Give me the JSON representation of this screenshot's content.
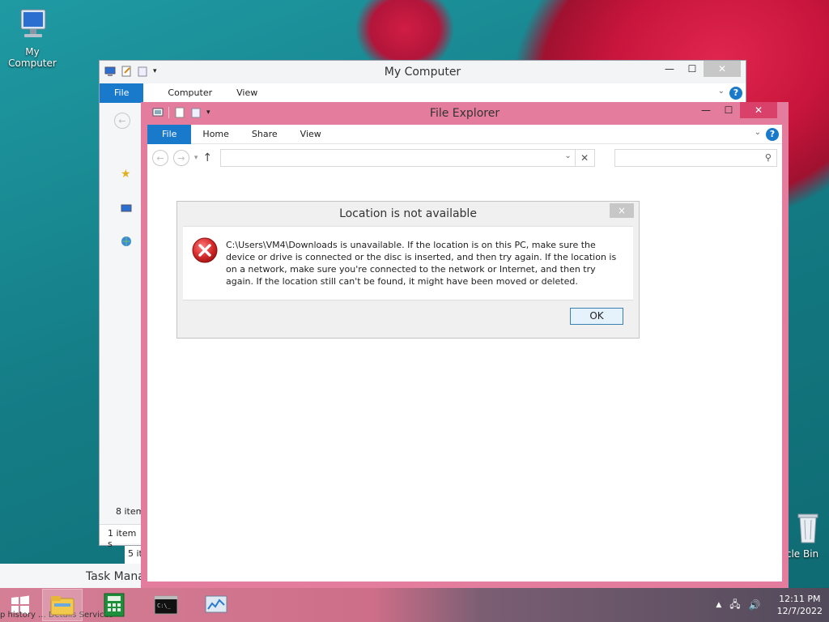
{
  "desktop": {
    "icons": [
      {
        "label": "My Computer",
        "icon": "computer-icon"
      },
      {
        "label": "cle Bin",
        "icon": "recycle-bin-icon"
      }
    ]
  },
  "my_computer_window": {
    "title": "My Computer",
    "tabs": [
      "File",
      "Computer",
      "View"
    ],
    "status_items": "8 item",
    "status_selected": "1 item s"
  },
  "task_manager_peek": {
    "title": "Task Mana",
    "count": "5 it",
    "tabs_text": "p history   ...   Details   Services"
  },
  "explorer_window": {
    "title": "File Explorer",
    "tabs": [
      "File",
      "Home",
      "Share",
      "View"
    ],
    "address_value": "",
    "search_placeholder": ""
  },
  "dialog": {
    "title": "Location is not available",
    "message": "C:\\Users\\VM4\\Downloads is unavailable. If the location is on this PC, make sure the device or drive is connected or the disc is inserted, and then try again. If the location is on a network, make sure you're connected to the network or Internet, and then try again. If the location still can't be found, it might have been moved or deleted.",
    "ok_label": "OK",
    "close_glyph": "×"
  },
  "taskbar": {
    "time": "12:11 PM",
    "date": "12/7/2022"
  },
  "colors": {
    "accent_blue": "#1979ca",
    "explorer_border": "#e47c9d",
    "error_red": "#d32f2f"
  }
}
